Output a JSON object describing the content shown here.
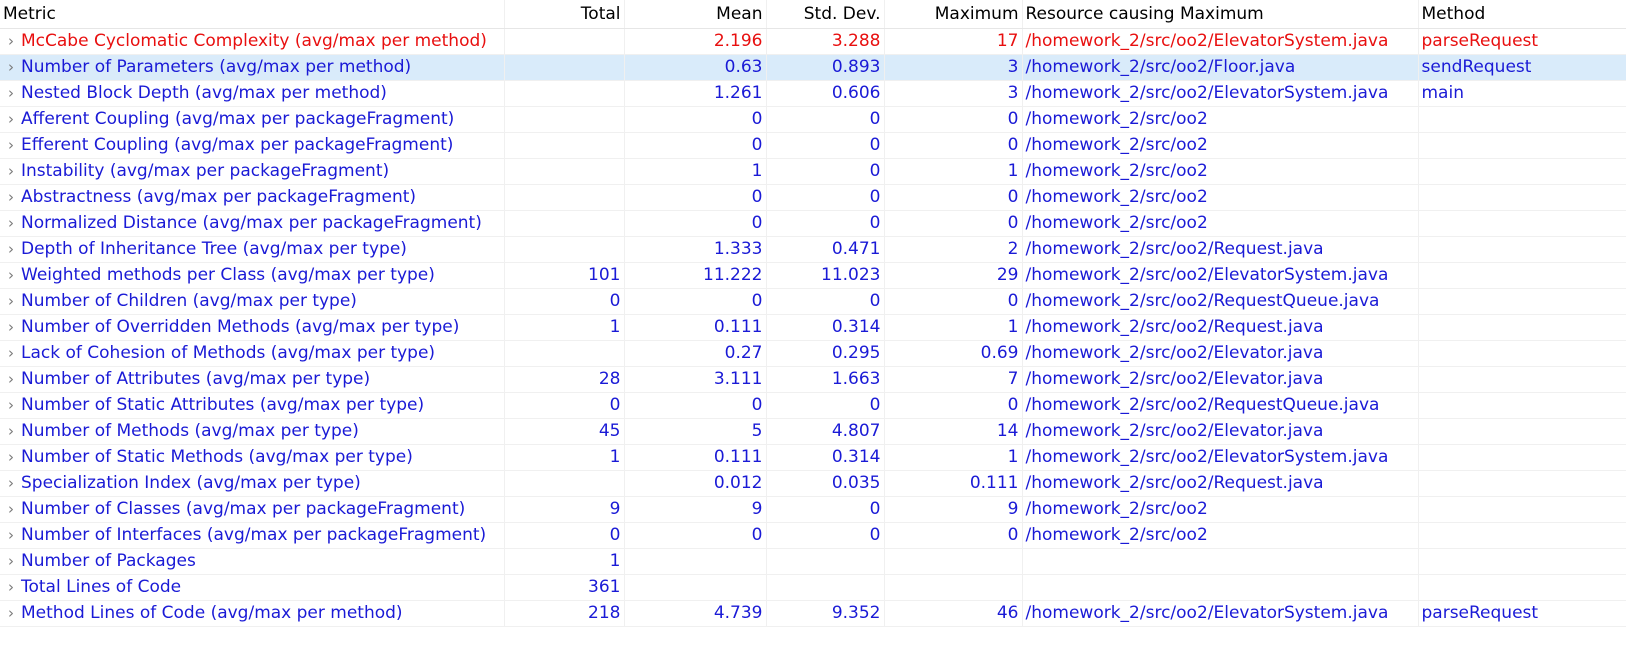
{
  "columns": {
    "metric": "Metric",
    "total": "Total",
    "mean": "Mean",
    "std": "Std. Dev.",
    "max": "Maximum",
    "resource": "Resource causing Maximum",
    "method": "Method"
  },
  "expand_icon": "chevron-right-icon",
  "colors": {
    "normal_text": "#1a1ad6",
    "error_text": "#e80f0f",
    "selected_row_bg": "#d9ebfa"
  },
  "rows": [
    {
      "metric": "McCabe Cyclomatic Complexity (avg/max per method)",
      "total": "",
      "mean": "2.196",
      "std": "3.288",
      "max": "17",
      "resource": "/homework_2/src/oo2/ElevatorSystem.java",
      "method": "parseRequest",
      "state": "error"
    },
    {
      "metric": "Number of Parameters (avg/max per method)",
      "total": "",
      "mean": "0.63",
      "std": "0.893",
      "max": "3",
      "resource": "/homework_2/src/oo2/Floor.java",
      "method": "sendRequest",
      "state": "selected"
    },
    {
      "metric": "Nested Block Depth (avg/max per method)",
      "total": "",
      "mean": "1.261",
      "std": "0.606",
      "max": "3",
      "resource": "/homework_2/src/oo2/ElevatorSystem.java",
      "method": "main",
      "state": ""
    },
    {
      "metric": "Afferent Coupling (avg/max per packageFragment)",
      "total": "",
      "mean": "0",
      "std": "0",
      "max": "0",
      "resource": "/homework_2/src/oo2",
      "method": "",
      "state": ""
    },
    {
      "metric": "Efferent Coupling (avg/max per packageFragment)",
      "total": "",
      "mean": "0",
      "std": "0",
      "max": "0",
      "resource": "/homework_2/src/oo2",
      "method": "",
      "state": ""
    },
    {
      "metric": "Instability (avg/max per packageFragment)",
      "total": "",
      "mean": "1",
      "std": "0",
      "max": "1",
      "resource": "/homework_2/src/oo2",
      "method": "",
      "state": ""
    },
    {
      "metric": "Abstractness (avg/max per packageFragment)",
      "total": "",
      "mean": "0",
      "std": "0",
      "max": "0",
      "resource": "/homework_2/src/oo2",
      "method": "",
      "state": ""
    },
    {
      "metric": "Normalized Distance (avg/max per packageFragment)",
      "total": "",
      "mean": "0",
      "std": "0",
      "max": "0",
      "resource": "/homework_2/src/oo2",
      "method": "",
      "state": ""
    },
    {
      "metric": "Depth of Inheritance Tree (avg/max per type)",
      "total": "",
      "mean": "1.333",
      "std": "0.471",
      "max": "2",
      "resource": "/homework_2/src/oo2/Request.java",
      "method": "",
      "state": ""
    },
    {
      "metric": "Weighted methods per Class (avg/max per type)",
      "total": "101",
      "mean": "11.222",
      "std": "11.023",
      "max": "29",
      "resource": "/homework_2/src/oo2/ElevatorSystem.java",
      "method": "",
      "state": ""
    },
    {
      "metric": "Number of Children (avg/max per type)",
      "total": "0",
      "mean": "0",
      "std": "0",
      "max": "0",
      "resource": "/homework_2/src/oo2/RequestQueue.java",
      "method": "",
      "state": ""
    },
    {
      "metric": "Number of Overridden Methods (avg/max per type)",
      "total": "1",
      "mean": "0.111",
      "std": "0.314",
      "max": "1",
      "resource": "/homework_2/src/oo2/Request.java",
      "method": "",
      "state": ""
    },
    {
      "metric": "Lack of Cohesion of Methods (avg/max per type)",
      "total": "",
      "mean": "0.27",
      "std": "0.295",
      "max": "0.69",
      "resource": "/homework_2/src/oo2/Elevator.java",
      "method": "",
      "state": ""
    },
    {
      "metric": "Number of Attributes (avg/max per type)",
      "total": "28",
      "mean": "3.111",
      "std": "1.663",
      "max": "7",
      "resource": "/homework_2/src/oo2/Elevator.java",
      "method": "",
      "state": ""
    },
    {
      "metric": "Number of Static Attributes (avg/max per type)",
      "total": "0",
      "mean": "0",
      "std": "0",
      "max": "0",
      "resource": "/homework_2/src/oo2/RequestQueue.java",
      "method": "",
      "state": ""
    },
    {
      "metric": "Number of Methods (avg/max per type)",
      "total": "45",
      "mean": "5",
      "std": "4.807",
      "max": "14",
      "resource": "/homework_2/src/oo2/Elevator.java",
      "method": "",
      "state": ""
    },
    {
      "metric": "Number of Static Methods (avg/max per type)",
      "total": "1",
      "mean": "0.111",
      "std": "0.314",
      "max": "1",
      "resource": "/homework_2/src/oo2/ElevatorSystem.java",
      "method": "",
      "state": ""
    },
    {
      "metric": "Specialization Index (avg/max per type)",
      "total": "",
      "mean": "0.012",
      "std": "0.035",
      "max": "0.111",
      "resource": "/homework_2/src/oo2/Request.java",
      "method": "",
      "state": ""
    },
    {
      "metric": "Number of Classes (avg/max per packageFragment)",
      "total": "9",
      "mean": "9",
      "std": "0",
      "max": "9",
      "resource": "/homework_2/src/oo2",
      "method": "",
      "state": ""
    },
    {
      "metric": "Number of Interfaces (avg/max per packageFragment)",
      "total": "0",
      "mean": "0",
      "std": "0",
      "max": "0",
      "resource": "/homework_2/src/oo2",
      "method": "",
      "state": ""
    },
    {
      "metric": "Number of Packages",
      "total": "1",
      "mean": "",
      "std": "",
      "max": "",
      "resource": "",
      "method": "",
      "state": ""
    },
    {
      "metric": "Total Lines of Code",
      "total": "361",
      "mean": "",
      "std": "",
      "max": "",
      "resource": "",
      "method": "",
      "state": ""
    },
    {
      "metric": "Method Lines of Code (avg/max per method)",
      "total": "218",
      "mean": "4.739",
      "std": "9.352",
      "max": "46",
      "resource": "/homework_2/src/oo2/ElevatorSystem.java",
      "method": "parseRequest",
      "state": ""
    }
  ]
}
